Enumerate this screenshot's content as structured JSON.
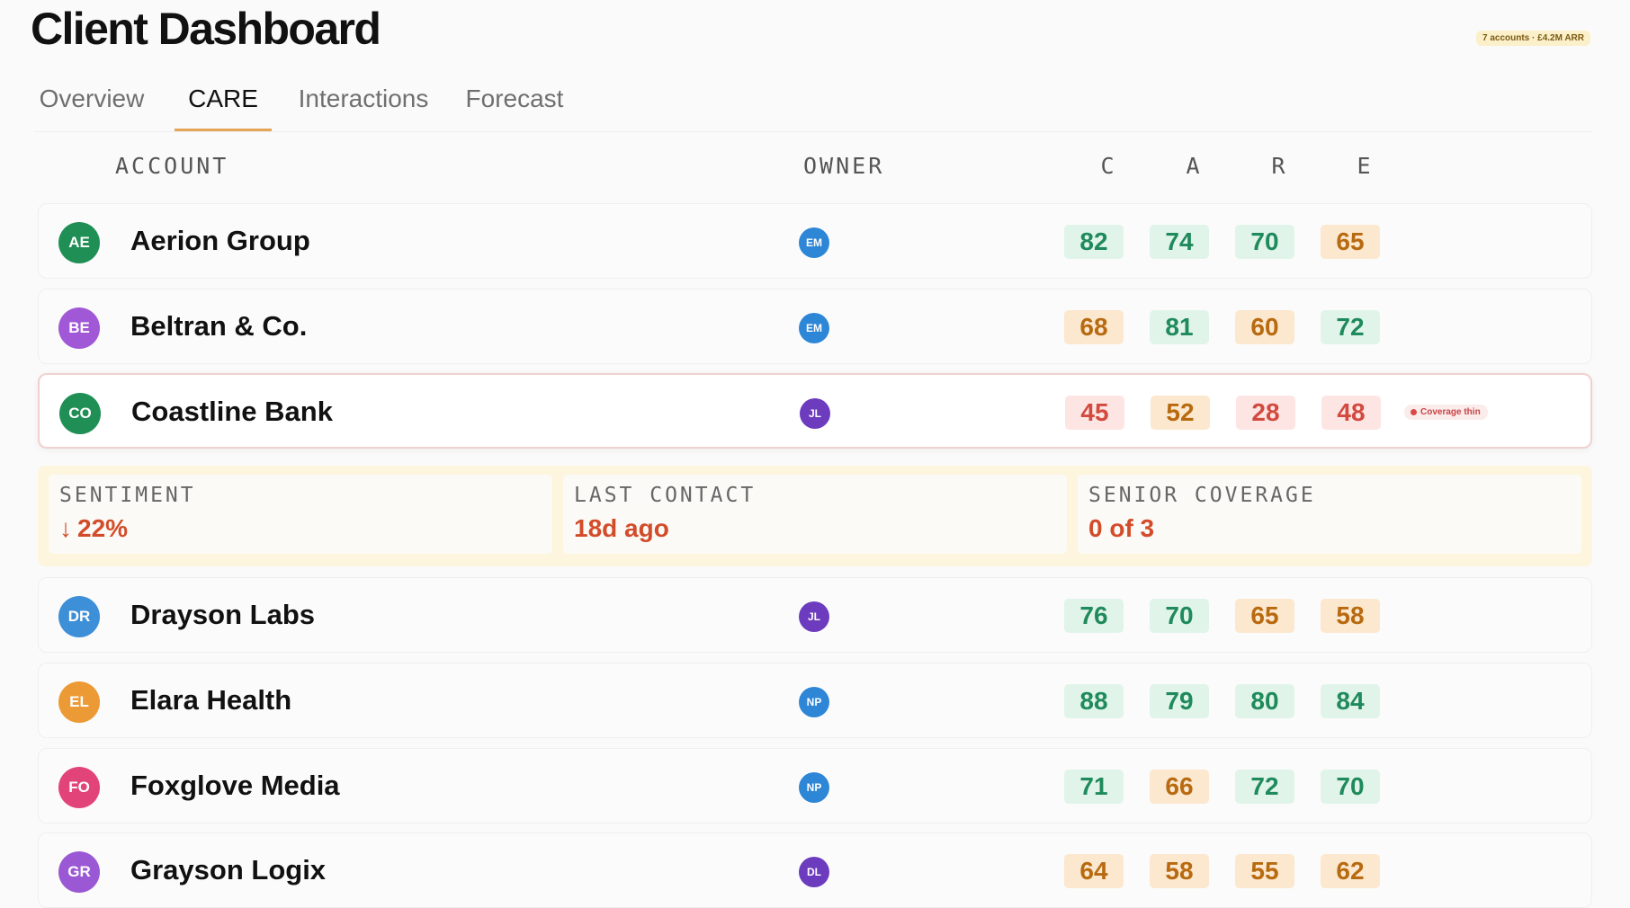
{
  "header": {
    "title": "Client Dashboard",
    "summary": "7 accounts · £4.2M ARR"
  },
  "tabs": [
    {
      "label": "Overview",
      "active": false
    },
    {
      "label": "CARE",
      "active": true
    },
    {
      "label": "Interactions",
      "active": false
    },
    {
      "label": "Forecast",
      "active": false
    }
  ],
  "columns": {
    "account": "ACCOUNT",
    "owner": "OWNER",
    "scores": [
      "C",
      "A",
      "R",
      "E"
    ]
  },
  "rows": [
    {
      "initials": "AE",
      "name": "Aerion Group",
      "avatar_color": "#1f8f55",
      "owner": "EM",
      "owner_color": "#2e86d6",
      "scores": [
        {
          "v": "82",
          "s": "g"
        },
        {
          "v": "74",
          "s": "g"
        },
        {
          "v": "70",
          "s": "g"
        },
        {
          "v": "65",
          "s": "o"
        }
      ]
    },
    {
      "initials": "BE",
      "name": "Beltran & Co.",
      "avatar_color": "#a158d6",
      "owner": "EM",
      "owner_color": "#2e86d6",
      "scores": [
        {
          "v": "68",
          "s": "o"
        },
        {
          "v": "81",
          "s": "g"
        },
        {
          "v": "60",
          "s": "o"
        },
        {
          "v": "72",
          "s": "g"
        }
      ]
    },
    {
      "initials": "CO",
      "name": "Coastline Bank",
      "avatar_color": "#1f8f55",
      "owner": "JL",
      "owner_color": "#6d3bbd",
      "scores": [
        {
          "v": "45",
          "s": "r"
        },
        {
          "v": "52",
          "s": "o"
        },
        {
          "v": "28",
          "s": "r"
        },
        {
          "v": "48",
          "s": "r"
        }
      ],
      "flag": "Coverage thin"
    },
    {
      "initials": "DR",
      "name": "Drayson Labs",
      "avatar_color": "#3d8fd8",
      "owner": "JL",
      "owner_color": "#6d3bbd",
      "scores": [
        {
          "v": "76",
          "s": "g"
        },
        {
          "v": "70",
          "s": "g"
        },
        {
          "v": "65",
          "s": "o"
        },
        {
          "v": "58",
          "s": "o"
        }
      ]
    },
    {
      "initials": "EL",
      "name": "Elara Health",
      "avatar_color": "#ec9a35",
      "owner": "NP",
      "owner_color": "#2e86d6",
      "scores": [
        {
          "v": "88",
          "s": "g"
        },
        {
          "v": "79",
          "s": "g"
        },
        {
          "v": "80",
          "s": "g"
        },
        {
          "v": "84",
          "s": "g"
        }
      ]
    },
    {
      "initials": "FO",
      "name": "Foxglove Media",
      "avatar_color": "#e2447a",
      "owner": "NP",
      "owner_color": "#2e86d6",
      "scores": [
        {
          "v": "71",
          "s": "g"
        },
        {
          "v": "66",
          "s": "o"
        },
        {
          "v": "72",
          "s": "g"
        },
        {
          "v": "70",
          "s": "g"
        }
      ]
    },
    {
      "initials": "GR",
      "name": "Grayson Logix",
      "avatar_color": "#9b58d4",
      "owner": "DL",
      "owner_color": "#6d3bbd",
      "scores": [
        {
          "v": "64",
          "s": "o"
        },
        {
          "v": "58",
          "s": "o"
        },
        {
          "v": "55",
          "s": "o"
        },
        {
          "v": "62",
          "s": "o"
        }
      ]
    }
  ],
  "detail": {
    "sentiment_label": "SENTIMENT",
    "sentiment_value": "22%",
    "sentiment_arrow": "↓",
    "last_contact_label": "LAST CONTACT",
    "last_contact_value": "18d ago",
    "coverage_label": "SENIOR COVERAGE",
    "coverage_value": "0 of 3"
  }
}
